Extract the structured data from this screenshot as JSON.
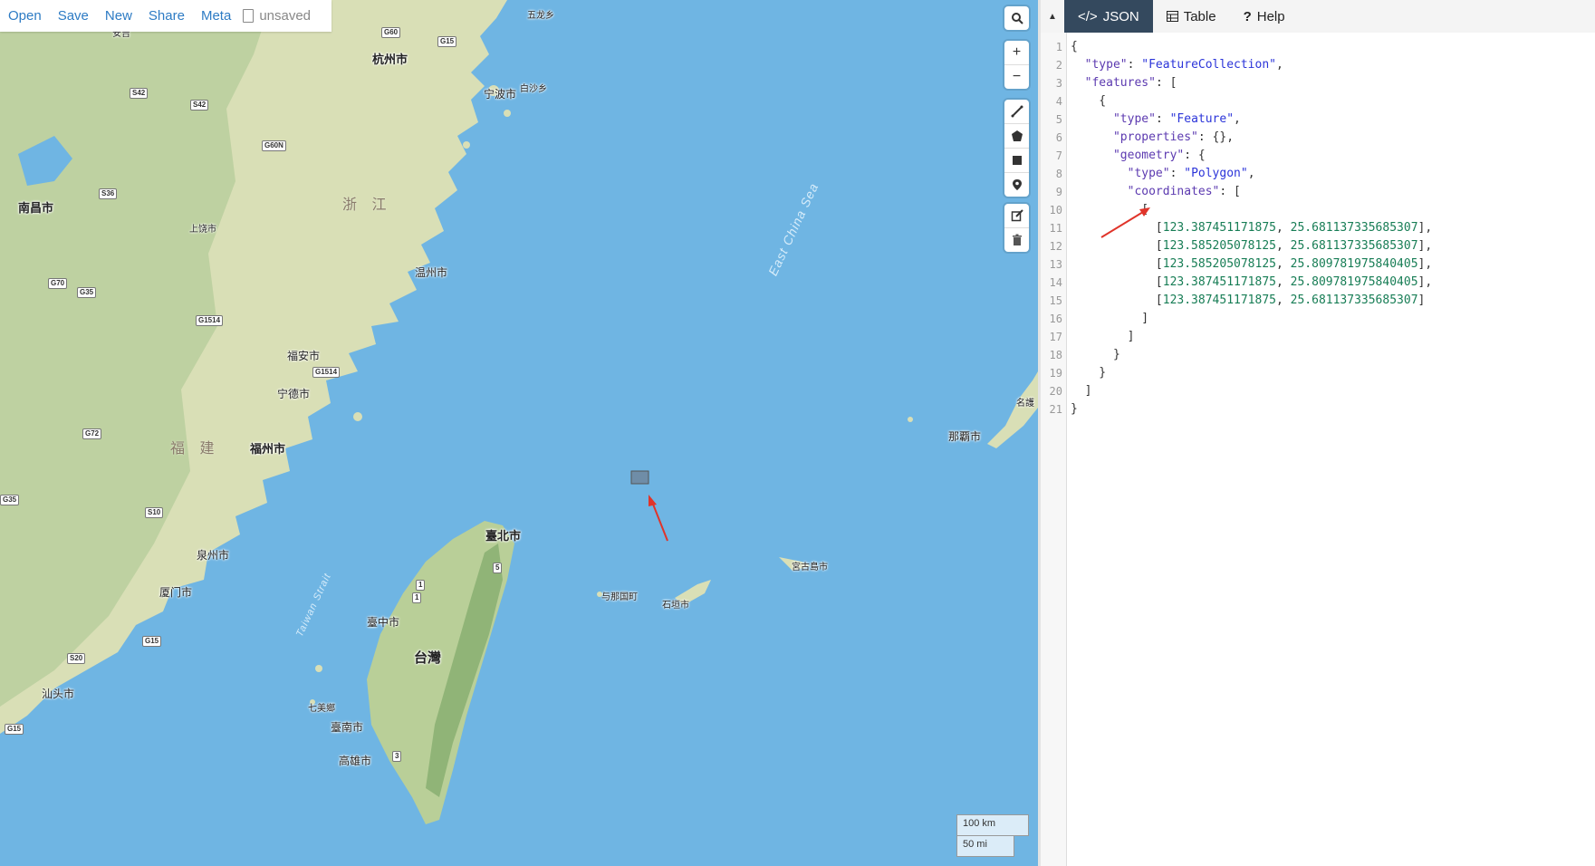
{
  "toolbar": {
    "open": "Open",
    "save": "Save",
    "new": "New",
    "share": "Share",
    "meta": "Meta",
    "status": "unsaved"
  },
  "map": {
    "provinces": [
      "浙 江",
      "福 建"
    ],
    "seas": [
      "East China Sea",
      "Taiwan Strait"
    ],
    "places": {
      "hangzhou": "杭州市",
      "ningbo": "宁波市",
      "baishaxiang": "白沙乡",
      "wulongxiang": "五龙乡",
      "anji": "安吉",
      "nanchang": "南昌市",
      "shangrao": "上饶市",
      "wenzhou": "温州市",
      "fuan": "福安市",
      "ningde": "宁德市",
      "fuzhou": "福州市",
      "quanzhou": "泉州市",
      "xiamen": "厦门市",
      "shantou": "汕头市",
      "taipei": "臺北市",
      "taiwan": "台灣",
      "taichung": "臺中市",
      "tainan": "臺南市",
      "kaohsiung": "高雄市",
      "qimei": "七美鄉",
      "yonaguni": "与那国町",
      "ishigaki": "石垣市",
      "miyakojima": "宮古島市",
      "naha": "那覇市",
      "nago": "名護"
    },
    "roads": [
      "G60",
      "G15",
      "S42",
      "S42",
      "G60N",
      "S36",
      "G70",
      "G35",
      "G1514",
      "G1514",
      "G72",
      "G35",
      "S10",
      "G15",
      "S20",
      "G15",
      "1",
      "1",
      "5",
      "3"
    ],
    "scale": {
      "metric": "100 km",
      "imperial": "50 mi"
    },
    "drawn_rectangle": {
      "west": 123.387451171875,
      "south": 25.681137335685307,
      "east": 123.585205078125,
      "north": 25.809781975840405
    }
  },
  "controls": {
    "search_icon": "search-icon",
    "zoom_in": "+",
    "zoom_out": "−",
    "draw_tools": [
      "line-icon",
      "polygon-icon",
      "rectangle-icon",
      "marker-icon"
    ],
    "edit_tools": [
      "edit-icon",
      "trash-icon"
    ]
  },
  "editor": {
    "collapse_glyph": "▲",
    "tabs": [
      {
        "label": "JSON",
        "icon": "code-icon",
        "active": true
      },
      {
        "label": "Table",
        "icon": "table-icon",
        "active": false
      },
      {
        "label": "Help",
        "icon": "help-icon",
        "active": false
      }
    ],
    "line_numbers": [
      "1",
      "2",
      "3",
      "4",
      "5",
      "6",
      "7",
      "8",
      "9",
      "10",
      "11",
      "12",
      "13",
      "14",
      "15",
      "16",
      "17",
      "18",
      "19",
      "20",
      "21"
    ],
    "code": {
      "type_key": "\"type\"",
      "type_val": "\"FeatureCollection\"",
      "features_key": "\"features\"",
      "feature_type_val": "\"Feature\"",
      "properties_key": "\"properties\"",
      "properties_val": "{}",
      "geometry_key": "\"geometry\"",
      "polygon_val": "\"Polygon\"",
      "coordinates_key": "\"coordinates\"",
      "coords": [
        [
          "123.387451171875",
          "25.681137335685307"
        ],
        [
          "123.585205078125",
          "25.681137335685307"
        ],
        [
          "123.585205078125",
          "25.809781975840405"
        ],
        [
          "123.387451171875",
          "25.809781975840405"
        ],
        [
          "123.387451171875",
          "25.681137335685307"
        ]
      ]
    }
  }
}
